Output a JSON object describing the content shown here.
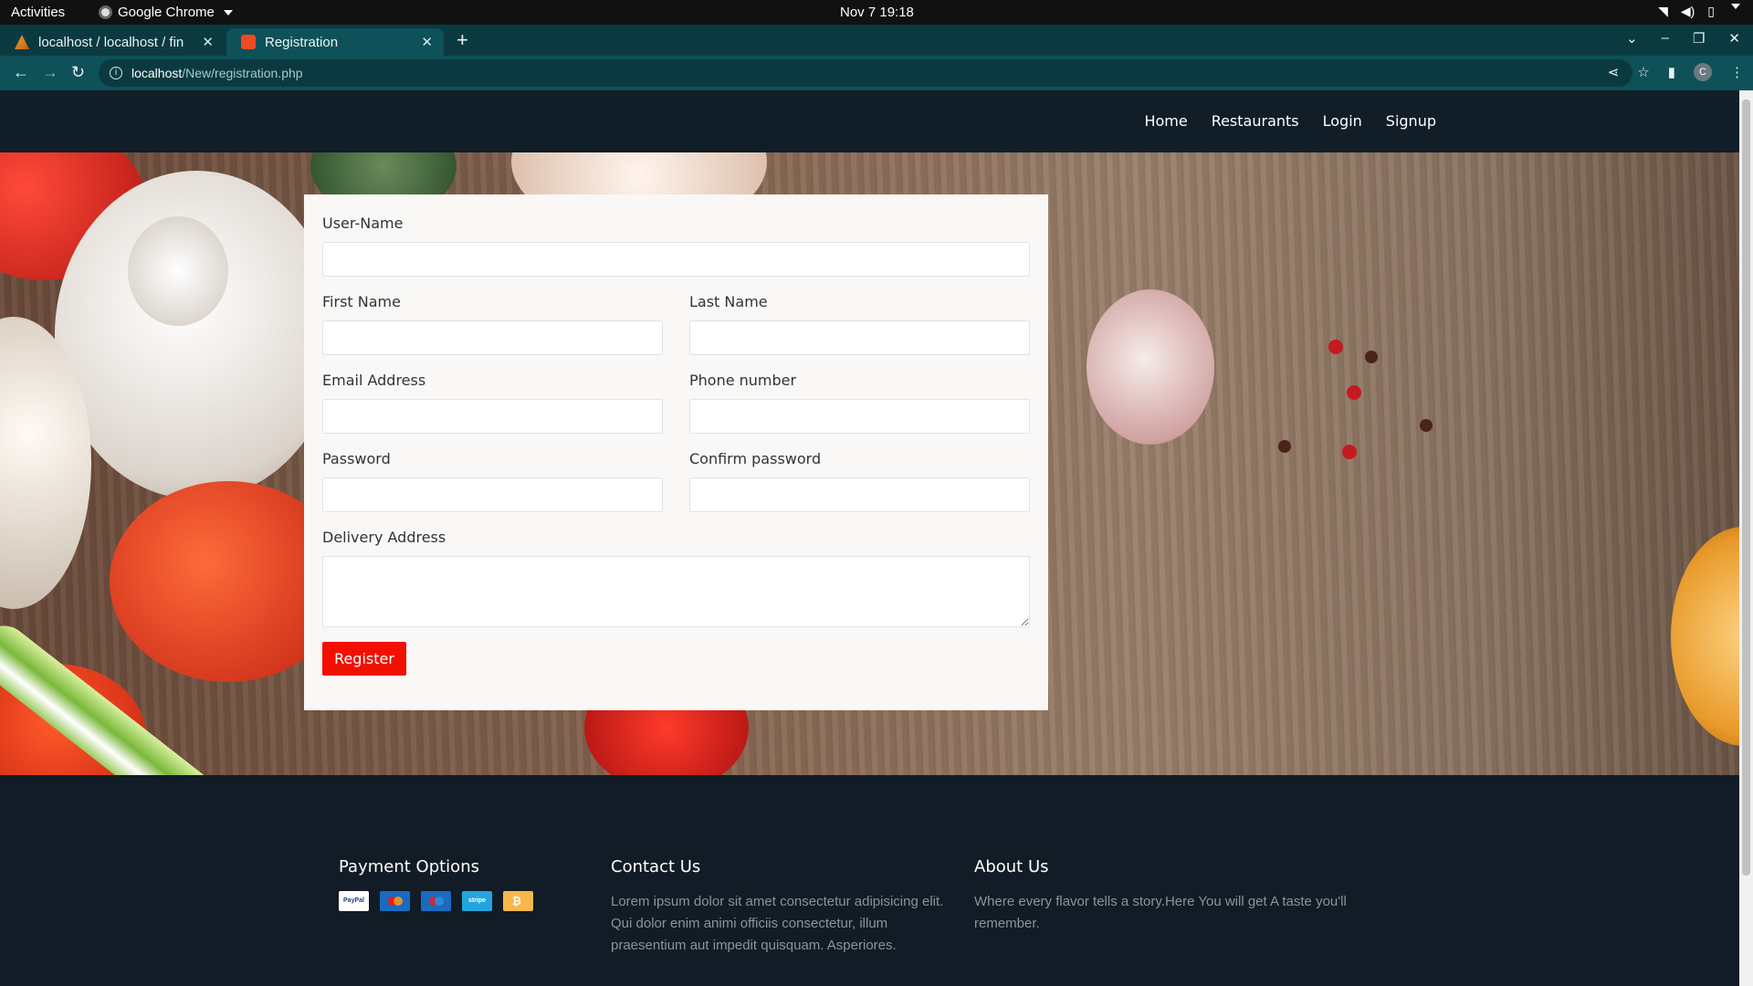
{
  "system_bar": {
    "activities": "Activities",
    "app_name": "Google Chrome",
    "clock": "Nov 7  19:18"
  },
  "browser": {
    "tabs": [
      {
        "title": "localhost / localhost / fin",
        "active": false
      },
      {
        "title": "Registration",
        "active": true
      }
    ],
    "url_host": "localhost",
    "url_path": "/New/registration.php",
    "profile_initial": "C"
  },
  "site": {
    "nav": [
      "Home",
      "Restaurants",
      "Login",
      "Signup"
    ],
    "form": {
      "username_label": "User-Name",
      "first_name_label": "First Name",
      "last_name_label": "Last Name",
      "email_label": "Email Address",
      "phone_label": "Phone number",
      "password_label": "Password",
      "confirm_password_label": "Confirm password",
      "address_label": "Delivery Address",
      "register_label": "Register"
    },
    "footer": {
      "payment_heading": "Payment Options",
      "payment_methods": [
        "PayPal",
        "Mastercard",
        "Maestro",
        "Stripe",
        "Bitcoin"
      ],
      "paypal_label": "PayPal",
      "stripe_label": "stripe",
      "contact_heading": "Contact Us",
      "contact_text": "Lorem ipsum dolor sit amet consectetur adipisicing elit. Qui dolor enim animi officiis consectetur, illum praesentium aut impedit quisquam. Asperiores.",
      "about_heading": "About Us",
      "about_text": "Where every flavor tells a story.Here You will get A taste you'll remember."
    }
  },
  "colors": {
    "register_button": "#f30f00",
    "footer_bg": "#111c26",
    "chrome_toolbar": "#0e5158"
  }
}
